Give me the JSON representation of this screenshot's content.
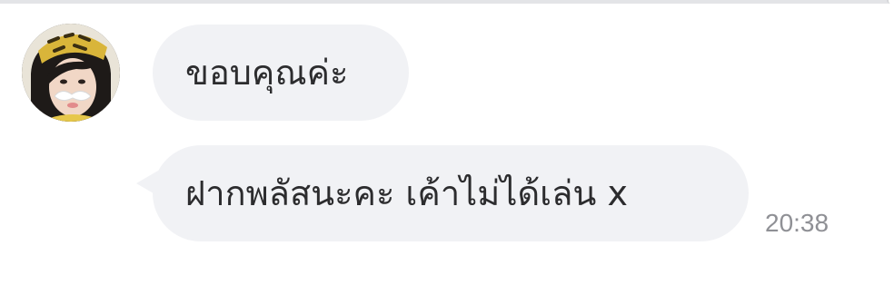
{
  "chat": {
    "messages": [
      {
        "text": "ขอบคุณค่ะ"
      },
      {
        "text": "ฝากพลัสนะคะ เค้าไม่ได้เล่น x"
      }
    ],
    "timestamp": "20:38"
  },
  "colors": {
    "bubble_background": "#f1f2f5",
    "text": "#2c2c2e",
    "timestamp": "#8f9095",
    "divider": "#e3e4e7"
  },
  "icons": {
    "avatar": "user-avatar-photo"
  }
}
